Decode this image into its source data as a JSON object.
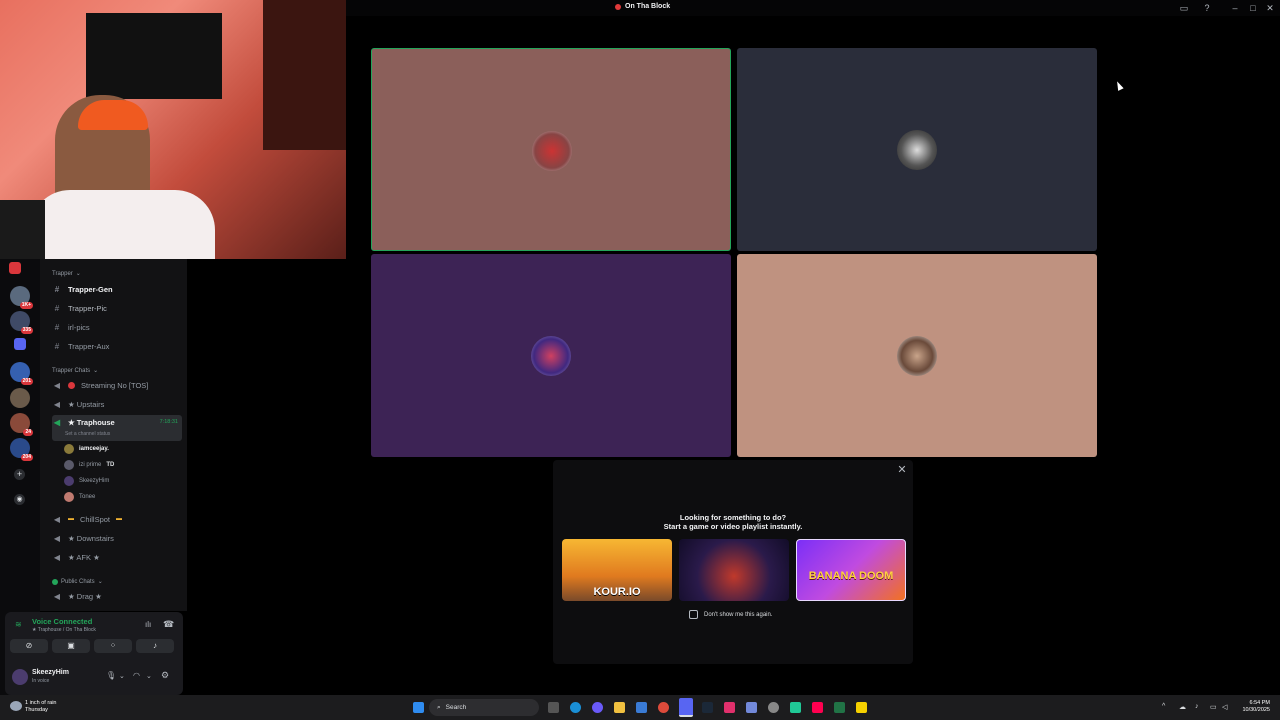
{
  "window": {
    "title": "On Tha Block"
  },
  "server_rail": {
    "badges": [
      "1K+",
      "335",
      "201",
      "24",
      "204"
    ]
  },
  "channels": {
    "category_trapper": "Trapper",
    "trapper_channels": [
      "Trapper-Gen",
      "Trapper-Pic",
      "irl-pics",
      "Trapper-Aux"
    ],
    "category_chats": "Trapper Chats",
    "streaming": "Streaming No [TOS]",
    "upstairs": "★ Upstairs",
    "traphouse": "★ Traphouse",
    "traphouse_timer": "7:18:31",
    "traphouse_status": "Set a channel status",
    "members": [
      "iamceejay.",
      "izi prime",
      "SkeezyHim",
      "Tonee"
    ],
    "member_tag": "TD",
    "chillspot": "ChillSpot",
    "downstairs": "★ Downstairs",
    "afk": "★ AFK ★",
    "category_public": "Public Chats",
    "drag": "★ Drag ★"
  },
  "voice_panel": {
    "status": "Voice Connected",
    "location": "★ Traphouse / On Tha Block",
    "username": "SkeezyHim",
    "user_status": "In voice"
  },
  "tiles": [
    {
      "bg": "#8b5f5a",
      "border": "#23a55a"
    },
    {
      "bg": "#2a2d3a",
      "border": "none"
    },
    {
      "bg": "#3d2355",
      "border": "none"
    },
    {
      "bg": "#bf9280",
      "border": "none"
    }
  ],
  "popup": {
    "heading": "Looking for something to do?",
    "subheading": "Start a game or video playlist instantly.",
    "games": [
      "KOUR.IO",
      "",
      "BANANA DOOM"
    ],
    "checkbox_label": "Don't show me this again."
  },
  "taskbar": {
    "weather_line1": "1 inch of rain",
    "weather_line2": "Thursday",
    "search_placeholder": "Search",
    "time": "6:54 PM",
    "date": "10/30/2025"
  }
}
